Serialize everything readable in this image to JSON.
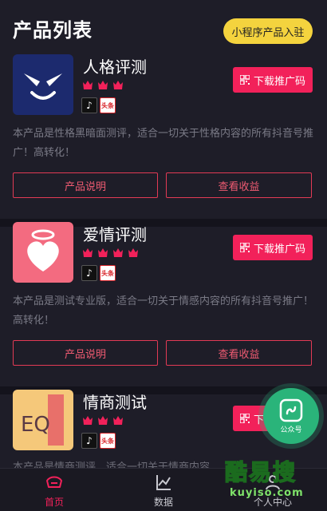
{
  "header": {
    "title": "产品列表",
    "mini_program_button": "小程序产品入驻"
  },
  "products": [
    {
      "name": "人格评测",
      "rating": 3,
      "platforms": [
        "抖音",
        "头条"
      ],
      "download_label": "下载推广码",
      "description": "本产品是性格黑暗面测评，适合一切关于性格内容的所有抖音号推广！高转化！",
      "actions": {
        "info": "产品说明",
        "earnings": "查看收益"
      },
      "thumb": {
        "bg": "#1c2a6e",
        "icon": "devil-face-icon"
      }
    },
    {
      "name": "爱情评测",
      "rating": 4,
      "platforms": [
        "抖音",
        "头条"
      ],
      "download_label": "下载推广码",
      "description": "本产品是测试专业版，适合一切关于情感内容的所有抖音号推广！高转化！",
      "actions": {
        "info": "产品说明",
        "earnings": "查看收益"
      },
      "thumb": {
        "bg": "#f36b80",
        "icon": "heart-halo-icon"
      }
    },
    {
      "name": "情商测试",
      "rating": 3,
      "platforms": [
        "抖音",
        "头条"
      ],
      "download_label": "下载推广码",
      "description": "本产品是情商测评，适合一切关于情商内容",
      "thumb": {
        "bg": "#f5c87a",
        "icon": "eq-logo-icon",
        "text": "EQ"
      }
    }
  ],
  "float_button": {
    "label": "公众号"
  },
  "tabbar": {
    "items": [
      {
        "label": "首页",
        "active": true
      },
      {
        "label": "数据",
        "active": false
      },
      {
        "label": "个人中心",
        "active": false
      }
    ]
  },
  "watermark": {
    "main": "酷易搜",
    "sub": "kuyiso.com"
  },
  "colors": {
    "accent": "#f2215a",
    "background": "#1e1d28",
    "badge": "#f4d33e"
  }
}
